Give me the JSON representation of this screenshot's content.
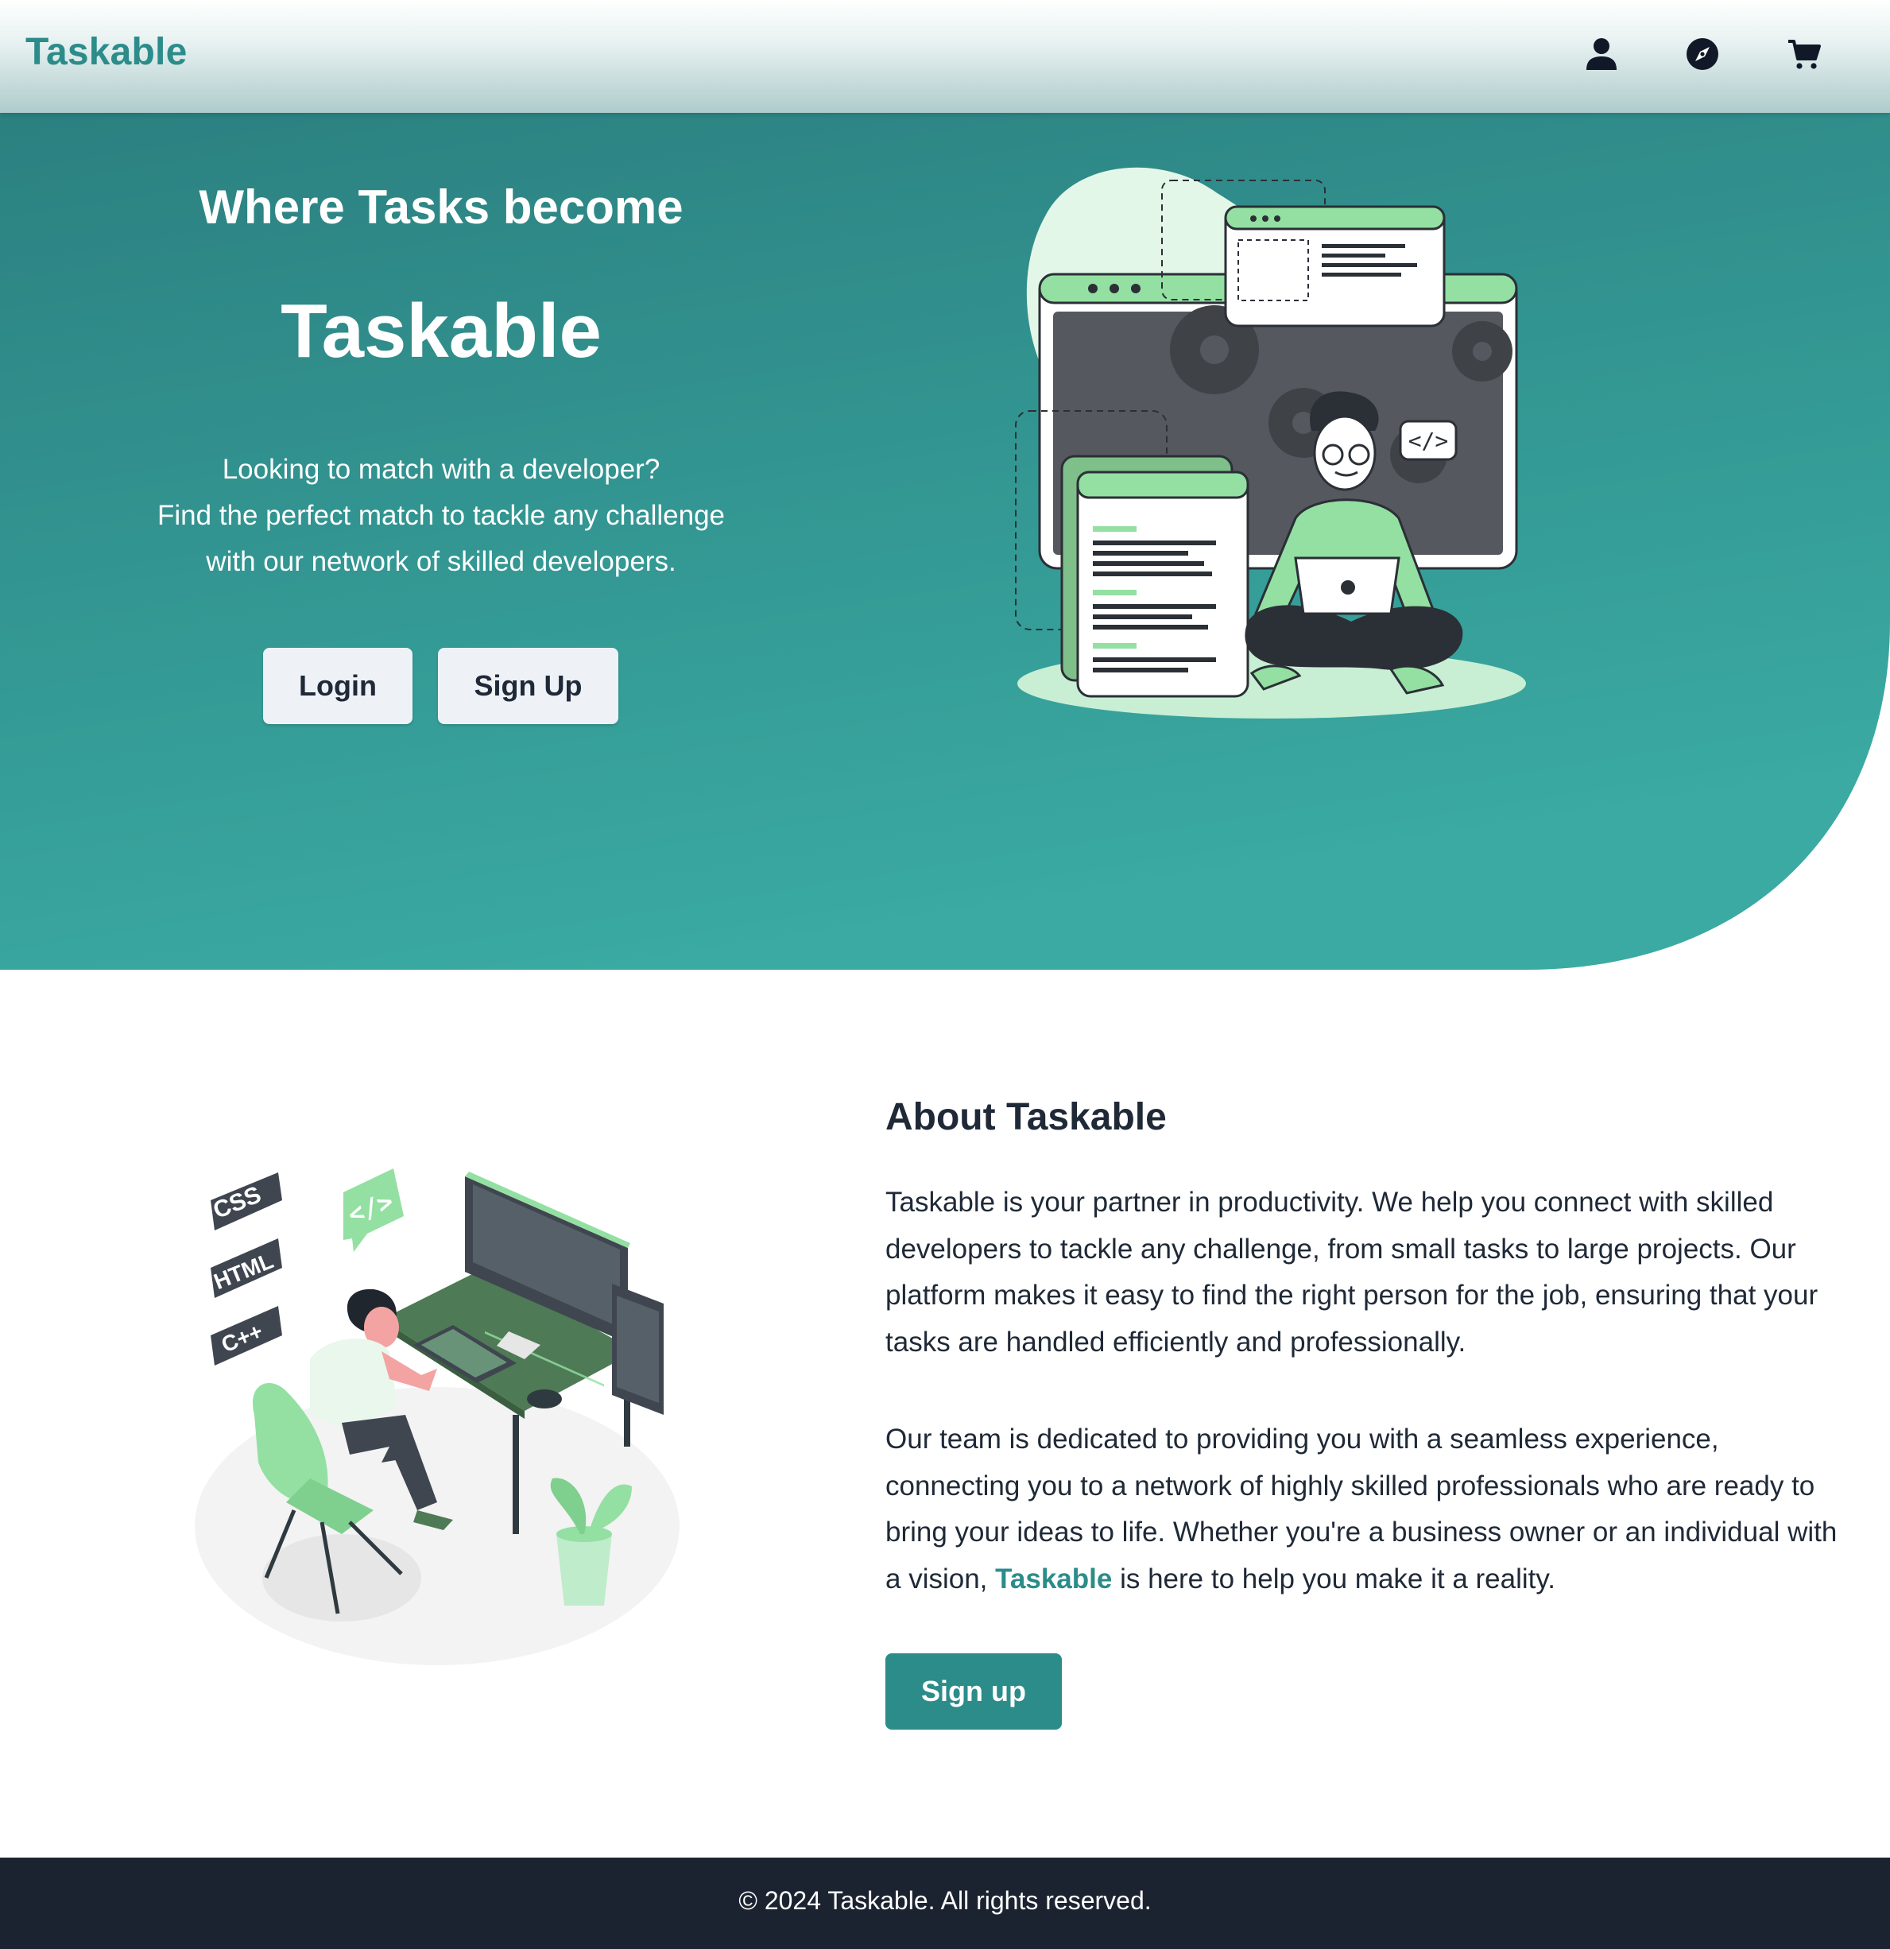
{
  "nav": {
    "brand": "Taskable",
    "icons": [
      "user-icon",
      "compass-icon",
      "cart-icon"
    ]
  },
  "hero": {
    "tagline": "Where Tasks become",
    "title": "Taskable",
    "description": [
      "Looking to match with a developer?",
      "Find the perfect match to tackle any challenge",
      "with our network of skilled developers."
    ],
    "login_label": "Login",
    "signup_label": "Sign Up"
  },
  "about": {
    "title": "About Taskable",
    "paragraph1": "Taskable is your partner in productivity. We help you connect with skilled developers to tackle any challenge, from small tasks to large projects. Our platform makes it easy to find the right person for the job, ensuring that your tasks are handled efficiently and professionally.",
    "paragraph2_before": "Our team is dedicated to providing you with a seamless experience, connecting you to a network of highly skilled professionals who are ready to bring your ideas to life. Whether you're a business owner or an individual with a vision, ",
    "paragraph2_brand": "Taskable",
    "paragraph2_after": " is here to help you make it a reality.",
    "signup_label": "Sign up",
    "badges": [
      "CSS",
      "HTML",
      "C++"
    ]
  },
  "footer": {
    "text": "© 2024 Taskable. All rights reserved."
  },
  "colors": {
    "brand": "#2b8c8a",
    "hero_start": "#2b8080",
    "hero_end": "#3aaaa2",
    "accent_green": "#93e0a2",
    "footer_bg": "#1c2330"
  }
}
